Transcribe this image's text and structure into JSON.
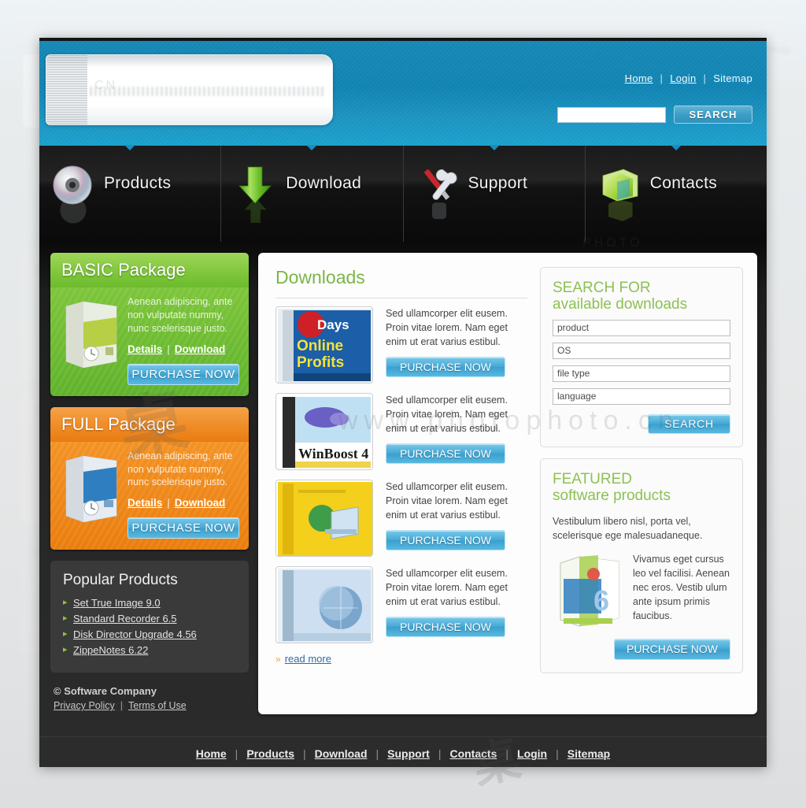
{
  "header": {
    "logo_alt": "software company logo",
    "top_links": [
      {
        "label": "Home",
        "name": "top-link-home"
      },
      {
        "label": "Login",
        "name": "top-link-login"
      },
      {
        "label": "Sitemap",
        "name": "top-link-sitemap"
      }
    ],
    "separator": "|",
    "search": {
      "value": "",
      "placeholder": "",
      "button_label": "SEARCH"
    }
  },
  "nav": {
    "items": [
      {
        "label": "Products",
        "icon": "cd-disc-icon"
      },
      {
        "label": "Download",
        "icon": "green-down-arrow-icon"
      },
      {
        "label": "Support",
        "icon": "wrench-screwdriver-icon"
      },
      {
        "label": "Contacts",
        "icon": "green-folder-icon"
      }
    ]
  },
  "sidebar": {
    "packages": [
      {
        "title": "BASIC Package",
        "description": "Aenean adipiscing, ante non vulputate nummy, nunc scelerisque justo.",
        "details_label": "Details",
        "download_label": "Download",
        "separator": "|",
        "purchase_label": "PURCHASE NOW",
        "accent": "#7ec63b",
        "boxshot": "green-software-box"
      },
      {
        "title": "FULL Package",
        "description": "Aenean adipiscing, ante non vulputate nummy, nunc scelerisque justo.",
        "details_label": "Details",
        "download_label": "Download",
        "separator": "|",
        "purchase_label": "PURCHASE NOW",
        "accent": "#ef8a24",
        "boxshot": "blue-software-box"
      }
    ],
    "popular": {
      "title": "Popular Products",
      "items": [
        "Set True Image 9.0",
        "Standard Recorder 6.5",
        "Disk Director Upgrade 4.56",
        "ZippeNotes 6.22"
      ]
    },
    "copyright": {
      "line": "© Software Company",
      "privacy_label": "Privacy Policy",
      "terms_label": "Terms of Use",
      "separator": "|"
    }
  },
  "downloads": {
    "title": "Downloads",
    "rows": [
      {
        "thumb": "30-days-to-online-profits-box",
        "text": "Sed ullamcorper elit eusem. Proin vitae lorem. Nam eget enim ut erat varius estibul.",
        "button_label": "PURCHASE NOW"
      },
      {
        "thumb": "winboost-4-box",
        "text": "Sed ullamcorper elit eusem. Proin vitae lorem. Nam eget enim ut erat varius estibul.",
        "button_label": "PURCHASE NOW"
      },
      {
        "thumb": "yellow-utility-box",
        "text": "Sed ullamcorper elit eusem. Proin vitae lorem. Nam eget enim ut erat varius estibul.",
        "button_label": "PURCHASE NOW"
      },
      {
        "thumb": "blue-globe-box",
        "text": "Sed ullamcorper elit eusem. Proin vitae lorem. Nam eget enim ut erat varius estibul.",
        "button_label": "PURCHASE NOW"
      }
    ],
    "read_more_label": "read more"
  },
  "search_panel": {
    "title_line1": "SEARCH FOR",
    "title_line2": "available downloads",
    "fields": [
      {
        "value": "product",
        "placeholder": "product",
        "name": "product-field"
      },
      {
        "value": "OS",
        "placeholder": "OS",
        "name": "os-field"
      },
      {
        "value": "file type",
        "placeholder": "file type",
        "name": "file-type-field"
      },
      {
        "value": "language",
        "placeholder": "language",
        "name": "language-field"
      }
    ],
    "button_label": "SEARCH"
  },
  "featured": {
    "title_line1": "FEATURED",
    "title_line2": "software products",
    "intro": "Vestibulum libero nisl, porta vel, scelerisque ege malesuadaneque.",
    "body": "Vivamus eget cursus leo vel facilisi. Aenean nec eros. Vestib ulum ante ipsum primis faucibus.",
    "boxshot": "green-blue-six-box",
    "button_label": "PURCHASE NOW"
  },
  "footer": {
    "links": [
      "Home",
      "Products",
      "Download",
      "Support",
      "Contacts",
      "Login",
      "Sitemap"
    ],
    "separator": "|"
  },
  "watermarks": {
    "photo": "PHOTO",
    "site": "www.photophoto.cn",
    "cn": "CN"
  },
  "colors": {
    "header_blue": "#1487b5",
    "accent_green": "#8cc152",
    "accent_orange": "#ef8a24",
    "button_blue": "#45a9d6",
    "dark_chrome": "#2a2a2a"
  }
}
